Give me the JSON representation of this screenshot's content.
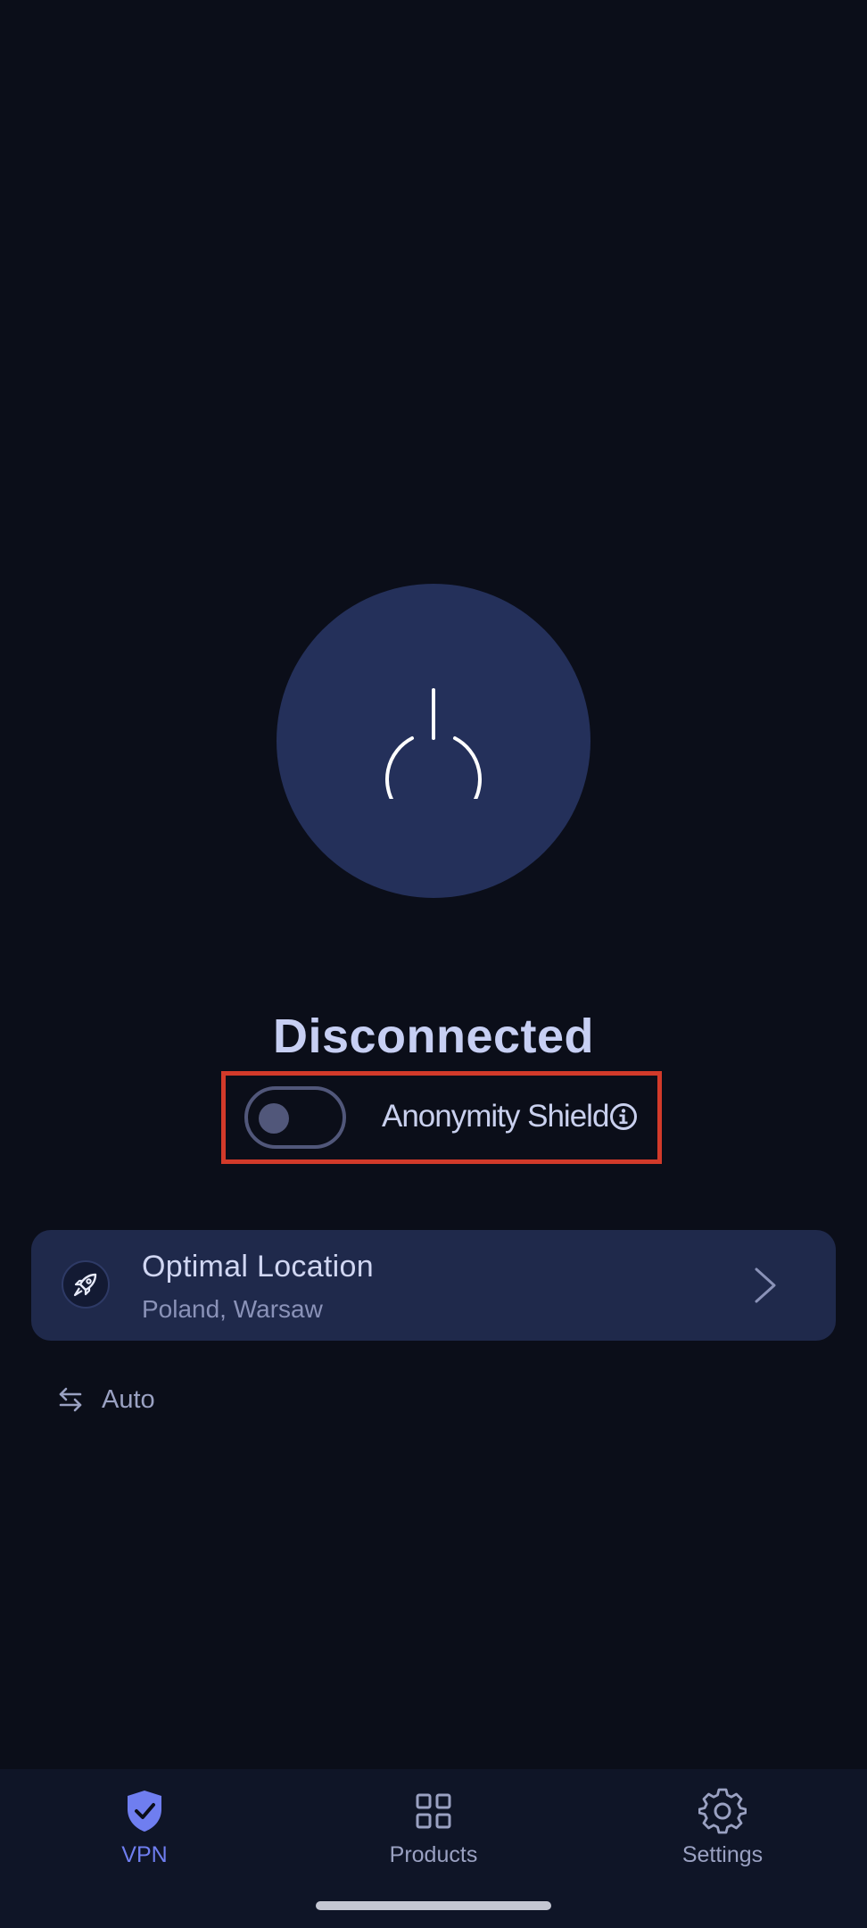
{
  "vpn": {
    "status": "Disconnected",
    "anonymity_shield": {
      "label": "Anonymity Shield",
      "enabled": false
    }
  },
  "location": {
    "title": "Optimal Location",
    "subtitle": "Poland, Warsaw"
  },
  "protocol": {
    "label": "Auto"
  },
  "nav": {
    "items": [
      {
        "label": "VPN",
        "icon": "shield-check-icon",
        "active": true
      },
      {
        "label": "Products",
        "icon": "grid-icon",
        "active": false
      },
      {
        "label": "Settings",
        "icon": "gear-icon",
        "active": false
      }
    ]
  },
  "colors": {
    "background": "#0b0e19",
    "power_button": "#24305a",
    "card": "#1f294b",
    "accent": "#6f7ef0",
    "highlight": "#d23a2a"
  }
}
